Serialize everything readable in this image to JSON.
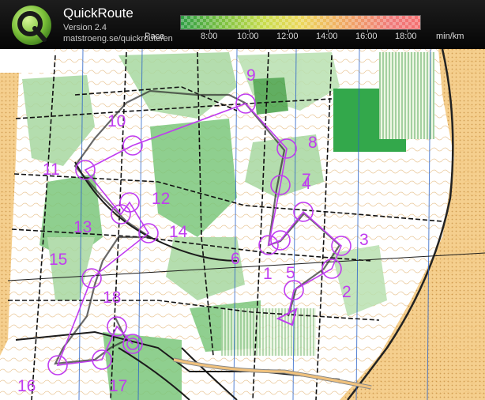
{
  "app": {
    "title": "QuickRoute",
    "version": "Version 2.4",
    "url": "matstroeng.se/quickroute/en",
    "logo_letter": "Q"
  },
  "pace_scale": {
    "label": "Pace",
    "unit": "min/km",
    "ticks": [
      "8:00",
      "10:00",
      "12:00",
      "14:00",
      "16:00",
      "18:00"
    ],
    "colors": {
      "fast": "#2f9e45",
      "mid": "#ecd85b",
      "slow": "#f47070"
    }
  },
  "map": {
    "course_color": "#c03cf0",
    "start_symbol": "triangle",
    "controls": [
      {
        "label": "1"
      },
      {
        "label": "2"
      },
      {
        "label": "3"
      },
      {
        "label": "4"
      },
      {
        "label": "5"
      },
      {
        "label": "6"
      },
      {
        "label": "7"
      },
      {
        "label": "8"
      },
      {
        "label": "9"
      },
      {
        "label": "10"
      },
      {
        "label": "11"
      },
      {
        "label": "12"
      },
      {
        "label": "13"
      },
      {
        "label": "14"
      },
      {
        "label": "15"
      },
      {
        "label": "16"
      },
      {
        "label": "17"
      },
      {
        "label": "18"
      }
    ]
  }
}
